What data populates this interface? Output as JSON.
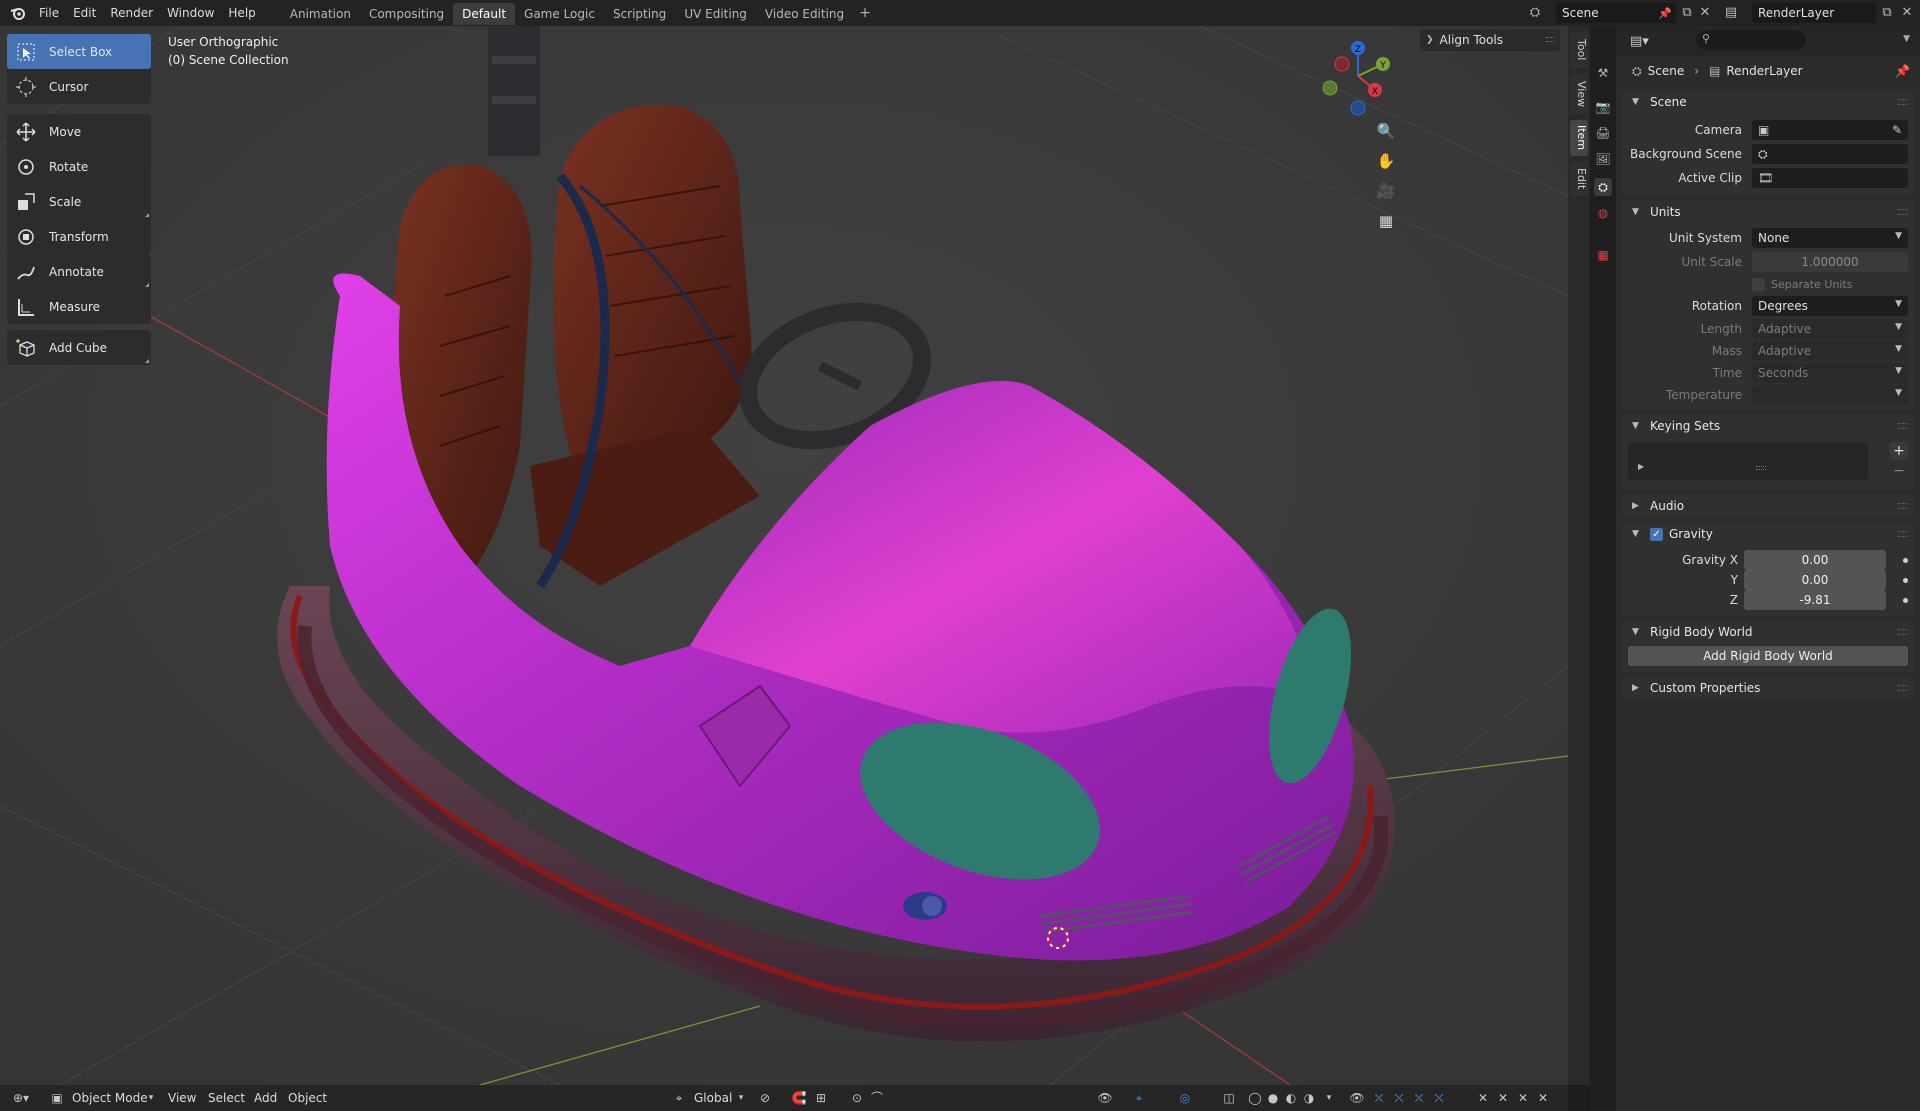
{
  "topbar": {
    "menus": [
      "File",
      "Edit",
      "Render",
      "Window",
      "Help"
    ],
    "workspaces": [
      "Animation",
      "Compositing",
      "Default",
      "Game Logic",
      "Scripting",
      "UV Editing",
      "Video Editing"
    ],
    "active_workspace": "Default",
    "add_workspace": "+",
    "scene_name": "Scene",
    "view_layer": "RenderLayer"
  },
  "viewport": {
    "view_name": "User Orthographic",
    "collection": "(0) Scene Collection",
    "align_tools": "Align Tools",
    "gizmo": {
      "z": "Z",
      "y": "Y",
      "x": "X"
    },
    "tools": [
      {
        "label": "Select Box",
        "icon": "select-box-icon",
        "active": true
      },
      {
        "label": "Cursor",
        "icon": "cursor-icon"
      },
      {
        "label": "Move",
        "icon": "move-icon"
      },
      {
        "label": "Rotate",
        "icon": "rotate-icon"
      },
      {
        "label": "Scale",
        "icon": "scale-icon"
      },
      {
        "label": "Transform",
        "icon": "transform-icon"
      },
      {
        "label": "Annotate",
        "icon": "annotate-icon"
      },
      {
        "label": "Measure",
        "icon": "measure-icon"
      },
      {
        "label": "Add Cube",
        "icon": "add-cube-icon"
      }
    ],
    "side_tabs": [
      "Tool",
      "View",
      "Item",
      "Edit"
    ],
    "active_side_tab": "Item",
    "colors": {
      "bg": "#3a3a3a",
      "car_body": "#b030c0",
      "seat": "#5a2418",
      "bumper": "#5a3a4a",
      "window": "#2f7a6e",
      "x_axis": "#c0393b",
      "y_axis": "#7ba334"
    }
  },
  "properties": {
    "breadcrumb": {
      "scene": "Scene",
      "layer": "RenderLayer"
    },
    "scene_panel": {
      "title": "Scene",
      "camera_label": "Camera",
      "background_scene_label": "Background Scene",
      "active_clip_label": "Active Clip"
    },
    "units_panel": {
      "title": "Units",
      "unit_system_label": "Unit System",
      "unit_system": "None",
      "unit_scale_label": "Unit Scale",
      "unit_scale": "1.000000",
      "separate_units": "Separate Units",
      "rotation_label": "Rotation",
      "rotation": "Degrees",
      "length_label": "Length",
      "length": "Adaptive",
      "mass_label": "Mass",
      "mass": "Adaptive",
      "time_label": "Time",
      "time": "Seconds",
      "temperature_label": "Temperature"
    },
    "keying_sets": {
      "title": "Keying Sets",
      "add": "+",
      "remove": "−"
    },
    "audio": {
      "title": "Audio"
    },
    "gravity": {
      "title": "Gravity",
      "enabled": true,
      "x_label": "Gravity X",
      "x": "0.00",
      "y_label": "Y",
      "y": "0.00",
      "z_label": "Z",
      "z": "-9.81"
    },
    "rigid_body": {
      "title": "Rigid Body World",
      "button": "Add Rigid Body World"
    },
    "custom_props": {
      "title": "Custom Properties"
    }
  },
  "bottombar": {
    "mode": "Object Mode",
    "menus": [
      "View",
      "Select",
      "Add",
      "Object"
    ],
    "orientation": "Global"
  }
}
